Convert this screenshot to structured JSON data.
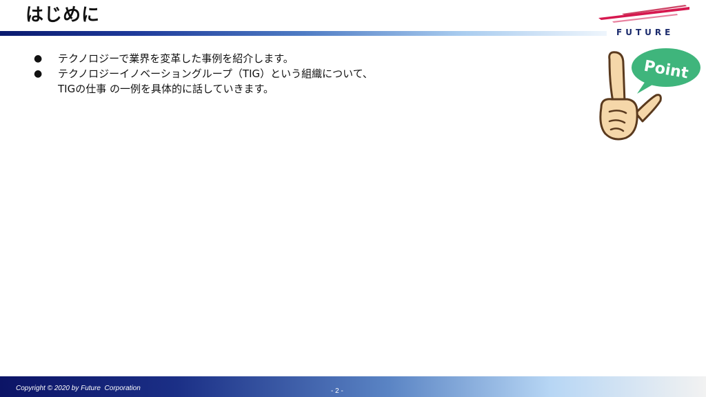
{
  "slide": {
    "title": "はじめに",
    "bullets": [
      {
        "bullet": "●",
        "lines": [
          "テクノロジーで業界を変革した事例を紹介します。"
        ]
      },
      {
        "bullet": "●",
        "lines": [
          "テクノロジーイノベーショングループ（TIG）という組織について、",
          "TIGの仕事 の一例を具体的に話していきます。"
        ]
      }
    ]
  },
  "logo": {
    "wordmark": "FUTURE",
    "accent_color": "#d6184f"
  },
  "illustration": {
    "speech_bubble_text": "Point",
    "bubble_color": "#3fb57c",
    "hand_color": "#f5d7a9"
  },
  "footer": {
    "copyright": "Copyright © 2020 by Future  Corporation",
    "page_number": "- 2 -"
  },
  "theme": {
    "navy": "#0c1466",
    "light_blue": "#b7d6f4"
  }
}
